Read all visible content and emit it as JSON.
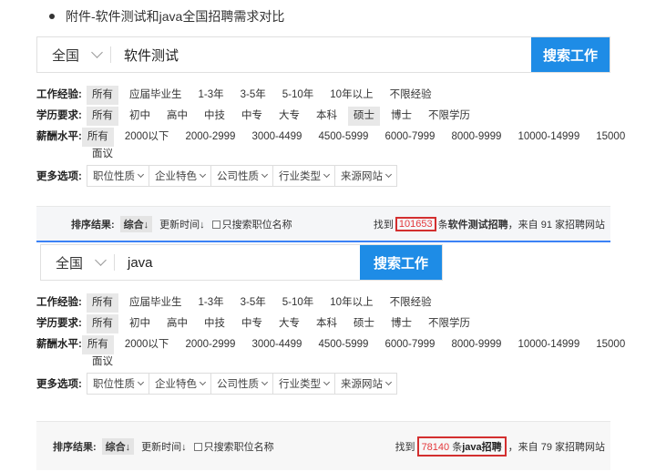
{
  "heading": "附件-软件测试和java全国招聘需求对比",
  "panels": [
    {
      "search": {
        "city": "全国",
        "keyword": "软件测试",
        "button": "搜索工作"
      },
      "filters": {
        "experience": {
          "label": "工作经验:",
          "options": [
            "所有",
            "应届毕业生",
            "1-3年",
            "3-5年",
            "5-10年",
            "10年以上",
            "不限经验"
          ]
        },
        "education": {
          "label": "学历要求:",
          "options": [
            "所有",
            "初中",
            "高中",
            "中技",
            "中专",
            "大专",
            "本科",
            "硕士",
            "博士",
            "不限学历"
          ]
        },
        "salary": {
          "label": "薪酬水平:",
          "options": [
            "所有",
            "2000以下",
            "2000-2999",
            "3000-4499",
            "4500-5999",
            "6000-7999",
            "8000-9999",
            "10000-14999",
            "15000"
          ],
          "overflow": "面议"
        },
        "more": {
          "label": "更多选项:",
          "options": [
            "职位性质",
            "企业特色",
            "公司性质",
            "行业类型",
            "来源网站"
          ]
        }
      },
      "sort": {
        "label": "排序结果:",
        "options": [
          "综合↓",
          "更新时间↓"
        ],
        "checkbox": "只搜索职位名称",
        "result_prefix": "找到",
        "count": "101653",
        "result_mid": "条",
        "result_kw": "软件测试招聘",
        "result_suffix": "，来自 91 家招聘网站"
      }
    },
    {
      "search": {
        "city": "全国",
        "keyword": "java",
        "button": "搜索工作"
      },
      "filters": {
        "experience": {
          "label": "工作经验:",
          "options": [
            "所有",
            "应届毕业生",
            "1-3年",
            "3-5年",
            "5-10年",
            "10年以上",
            "不限经验"
          ]
        },
        "education": {
          "label": "学历要求:",
          "options": [
            "所有",
            "初中",
            "高中",
            "中技",
            "中专",
            "大专",
            "本科",
            "硕士",
            "博士",
            "不限学历"
          ]
        },
        "salary": {
          "label": "薪酬水平:",
          "options": [
            "所有",
            "2000以下",
            "2000-2999",
            "3000-4499",
            "4500-5999",
            "6000-7999",
            "8000-9999",
            "10000-14999",
            "15000"
          ],
          "overflow": "面议"
        },
        "more": {
          "label": "更多选项:",
          "options": [
            "职位性质",
            "企业特色",
            "公司性质",
            "行业类型",
            "来源网站"
          ]
        }
      },
      "sort": {
        "label": "排序结果:",
        "options": [
          "综合↓",
          "更新时间↓"
        ],
        "checkbox": "只搜索职位名称",
        "result_prefix": "找到",
        "count": "78140",
        "result_mid": "条",
        "result_kw": "java招聘",
        "result_suffix": "，来自 79 家招聘网站"
      }
    }
  ]
}
